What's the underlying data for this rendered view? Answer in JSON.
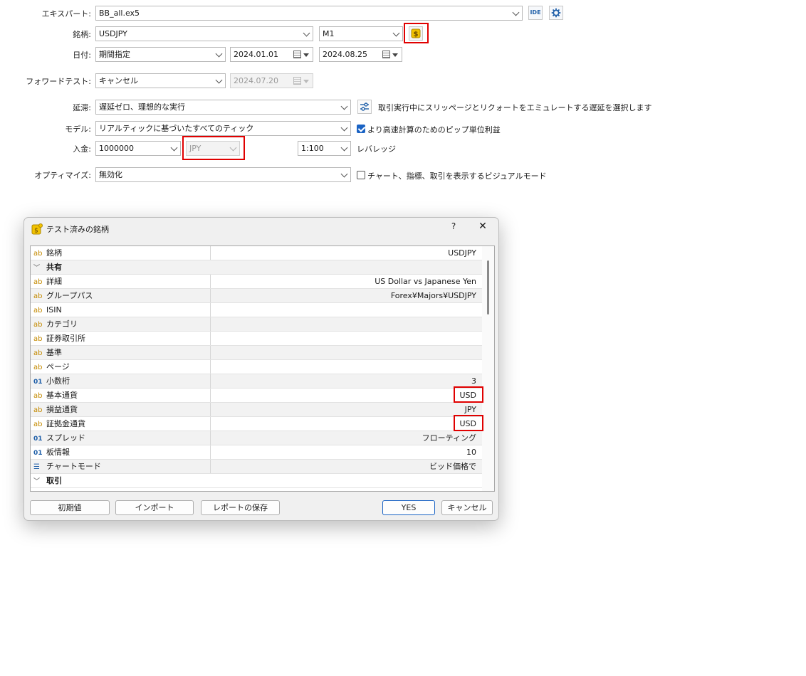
{
  "form": {
    "expert_label": "エキスパート:",
    "expert_value": "BB_all.ex5",
    "ide_label": "IDE",
    "symbol_label": "銘柄:",
    "symbol_value": "USDJPY",
    "timeframe_value": "M1",
    "date_label": "日付:",
    "date_mode": "期間指定",
    "date_from": "2024.01.01",
    "date_to": "2024.08.25",
    "forward_label": "フォワードテスト:",
    "forward_value": "キャンセル",
    "forward_date": "2024.07.20",
    "delay_label": "延滞:",
    "delay_value": "遅延ゼロ、理想的な実行",
    "delay_hint": "取引実行中にスリッページとリクォートをエミュレートする遅延を選択します",
    "model_label": "モデル:",
    "model_value": "リアルティックに基づいたすべてのティック",
    "pips_check_label": "より高速計算のためのピップ単位利益",
    "pips_checked": true,
    "deposit_label": "入金:",
    "deposit_value": "1000000",
    "currency_value": "JPY",
    "leverage_value": "1:100",
    "leverage_label": "レバレッジ",
    "optimize_label": "オプティマイズ:",
    "optimize_value": "無効化",
    "visual_check_label": "チャート、指標、取引を表示するビジュアルモード",
    "visual_checked": false
  },
  "dialog": {
    "title": "テスト済みの銘柄",
    "help_label": "?",
    "close_label": "✕",
    "rows": [
      {
        "type": "item",
        "icon": "ab",
        "name": "銘柄",
        "value": "USDJPY"
      },
      {
        "type": "group",
        "name": "共有"
      },
      {
        "type": "item",
        "icon": "ab",
        "name": "詳細",
        "value": "US Dollar vs Japanese Yen"
      },
      {
        "type": "item",
        "icon": "ab",
        "name": "グループパス",
        "value": "Forex¥Majors¥USDJPY"
      },
      {
        "type": "item",
        "icon": "ab",
        "name": "ISIN",
        "value": ""
      },
      {
        "type": "item",
        "icon": "ab",
        "name": "カテゴリ",
        "value": ""
      },
      {
        "type": "item",
        "icon": "ab",
        "name": "証券取引所",
        "value": ""
      },
      {
        "type": "item",
        "icon": "ab",
        "name": "基準",
        "value": ""
      },
      {
        "type": "item",
        "icon": "ab",
        "name": "ページ",
        "value": ""
      },
      {
        "type": "item",
        "icon": "01",
        "name": "小数桁",
        "value": "3"
      },
      {
        "type": "item",
        "icon": "ab",
        "name": "基本通貨",
        "value": "USD"
      },
      {
        "type": "item",
        "icon": "ab",
        "name": "損益通貨",
        "value": "JPY"
      },
      {
        "type": "item",
        "icon": "ab",
        "name": "証拠金通貨",
        "value": "USD"
      },
      {
        "type": "item",
        "icon": "01",
        "name": "スプレッド",
        "value": "フローティング"
      },
      {
        "type": "item",
        "icon": "01",
        "name": "板情報",
        "value": "10"
      },
      {
        "type": "item",
        "icon": "stack",
        "name": "チャートモード",
        "value": "ビッド価格で"
      },
      {
        "type": "group",
        "name": "取引"
      }
    ],
    "buttons": {
      "reset": "初期値",
      "import": "インポート",
      "save_report": "レポートの保存",
      "yes": "YES",
      "cancel": "キャンセル"
    }
  },
  "colors": {
    "highlight": "#e00000",
    "accent": "#1a63c4",
    "coin": "#f2c200"
  }
}
